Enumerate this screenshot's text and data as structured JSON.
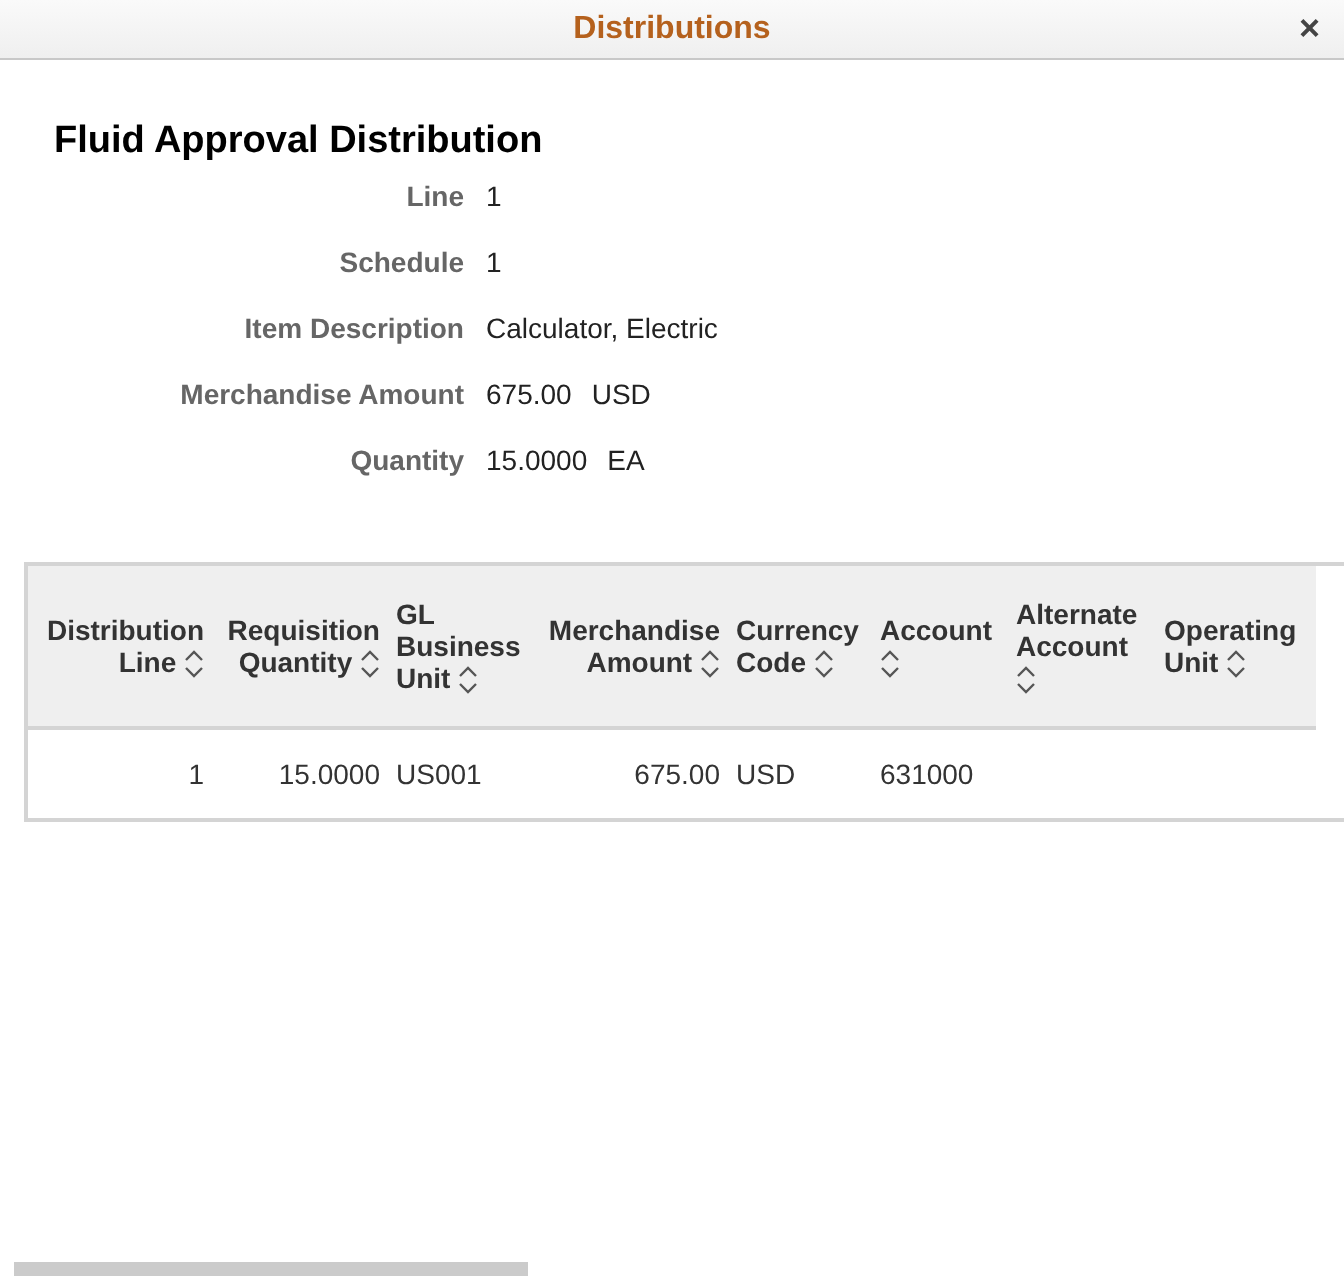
{
  "window": {
    "title": "Distributions",
    "close": "×"
  },
  "heading": "Fluid Approval Distribution",
  "fields": [
    {
      "label": "Line",
      "value": "1"
    },
    {
      "label": "Schedule",
      "value": "1"
    },
    {
      "label": "Item Description",
      "value": "Calculator, Electric"
    },
    {
      "label": "Merchandise Amount",
      "value": "675.00",
      "unit": "USD"
    },
    {
      "label": "Quantity",
      "value": "15.0000",
      "unit": "EA"
    }
  ],
  "table": {
    "columns": [
      {
        "label": "Distribution Line",
        "kind": "number"
      },
      {
        "label": "Requisition Quantity",
        "kind": "number"
      },
      {
        "label": "GL Business Unit",
        "kind": "text"
      },
      {
        "label": "Merchandise Amount",
        "kind": "number"
      },
      {
        "label": "Currency Code",
        "kind": "text"
      },
      {
        "label": "Account",
        "kind": "text"
      },
      {
        "label": "Alternate Account",
        "kind": "text"
      },
      {
        "label": "Operating Unit",
        "kind": "text"
      }
    ],
    "rows": [
      [
        "1",
        "15.0000",
        "US001",
        "675.00",
        "USD",
        "631000",
        "",
        ""
      ]
    ]
  }
}
